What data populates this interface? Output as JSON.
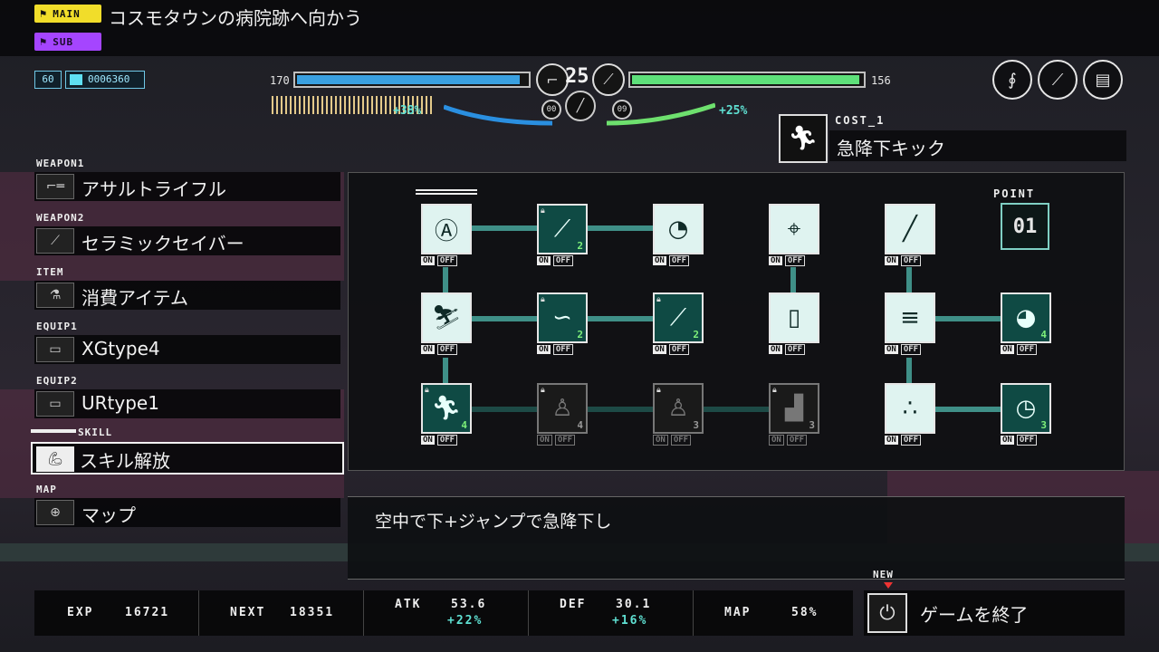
{
  "quest": {
    "main_tag": "MAIN",
    "sub_tag": "SUB",
    "main_text": "コスモタウンの病院跡へ向かう"
  },
  "hud": {
    "level": "60",
    "money": "0006360",
    "player_hp_value": "170",
    "player_hp_fill": 0.97,
    "enemy_value": "156",
    "enemy_fill": 0.99,
    "center_level": "25",
    "left_gauge_counter": "00",
    "right_gauge_counter": "09",
    "left_gauge_pct": "+38%",
    "right_gauge_pct": "+25%",
    "top_icons": [
      "whip-icon",
      "staff-icon",
      "chip-icon"
    ]
  },
  "cost": {
    "label": "COST_1",
    "skill_name": "急降下キック",
    "icon": "dive-kick-icon"
  },
  "menu": [
    {
      "category": "WEAPON1",
      "label": "アサルトライフル",
      "icon": "rifle-icon"
    },
    {
      "category": "WEAPON2",
      "label": "セラミックセイバー",
      "icon": "saber-icon"
    },
    {
      "category": "ITEM",
      "label": "消費アイテム",
      "icon": "flask-icon"
    },
    {
      "category": "EQUIP1",
      "label": "XGtype4",
      "icon": "chip-icon"
    },
    {
      "category": "EQUIP2",
      "label": "URtype1",
      "icon": "chip-icon"
    },
    {
      "category": "SKILL",
      "label": "スキル解放",
      "icon": "arm-icon"
    },
    {
      "category": "MAP",
      "label": "マップ",
      "icon": "map-pin-icon"
    }
  ],
  "tree": {
    "point_label": "POINT",
    "points": "01",
    "on_label": "ON",
    "off_label": "OFF",
    "nodes": [
      {
        "id": "r1c1",
        "state": "unlocked",
        "icon": "target-a-icon",
        "count": "",
        "lock": false
      },
      {
        "id": "r1c2",
        "state": "active",
        "icon": "sword-icon",
        "count": "2",
        "lock": true
      },
      {
        "id": "r1c3",
        "state": "unlocked",
        "icon": "slash-icon",
        "count": "",
        "lock": false
      },
      {
        "id": "r1c4",
        "state": "unlocked",
        "icon": "crosshair-icon",
        "count": "",
        "lock": false
      },
      {
        "id": "r1c5",
        "state": "unlocked",
        "icon": "blade-icon",
        "count": "",
        "lock": false
      },
      {
        "id": "r2c1",
        "state": "unlocked",
        "icon": "dive-kick-icon",
        "count": "",
        "lock": false
      },
      {
        "id": "r2c2",
        "state": "active",
        "icon": "roll-icon",
        "count": "2",
        "lock": true
      },
      {
        "id": "r2c3",
        "state": "active",
        "icon": "sword-icon",
        "count": "2",
        "lock": true
      },
      {
        "id": "r2c4",
        "state": "unlocked",
        "icon": "door-icon",
        "count": "",
        "lock": false
      },
      {
        "id": "r2c5",
        "state": "unlocked",
        "icon": "multi-shot-icon",
        "count": "",
        "lock": false
      },
      {
        "id": "r2c6",
        "state": "active",
        "icon": "dash-orb-icon",
        "count": "4",
        "lock": false
      },
      {
        "id": "r3c1",
        "state": "active",
        "icon": "run-icon",
        "count": "4",
        "lock": true
      },
      {
        "id": "r3c2",
        "state": "locked",
        "icon": "stand-icon",
        "count": "4",
        "lock": true
      },
      {
        "id": "r3c3",
        "state": "locked",
        "icon": "stand-icon",
        "count": "3",
        "lock": true
      },
      {
        "id": "r3c4",
        "state": "locked",
        "icon": "crouch-icon",
        "count": "3",
        "lock": true
      },
      {
        "id": "r3c5",
        "state": "unlocked",
        "icon": "drops-icon",
        "count": "",
        "lock": false
      },
      {
        "id": "r3c6",
        "state": "active",
        "icon": "timer-icon",
        "count": "3",
        "lock": false
      }
    ]
  },
  "description": "空中で下+ジャンプで急降下し",
  "stats": {
    "exp_label": "EXP",
    "exp_value": "16721",
    "next_label": "NEXT",
    "next_value": "18351",
    "atk_label": "ATK",
    "atk_value": "53.6",
    "atk_bonus": "+22%",
    "def_label": "DEF",
    "def_value": "30.1",
    "def_bonus": "+16%",
    "map_label": "MAP",
    "map_value": "58%"
  },
  "quit": {
    "new_badge": "NEW",
    "label": "ゲームを終了",
    "icon": "power-icon"
  }
}
